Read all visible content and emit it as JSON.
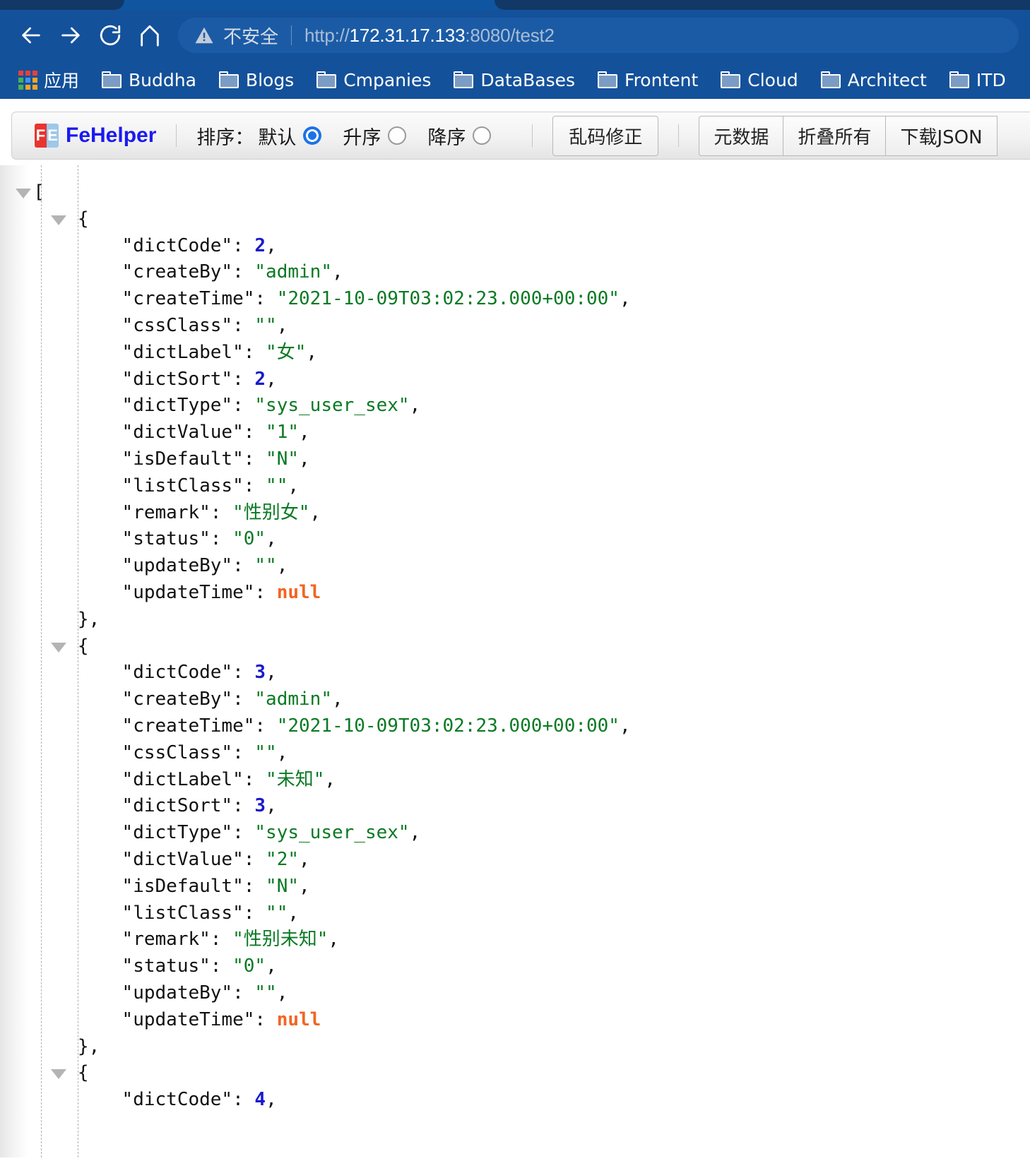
{
  "browser": {
    "tabs": [
      {
        "name": "inactive-tab-left",
        "active": false
      },
      {
        "name": "active-tab",
        "active": true
      },
      {
        "name": "inactive-tab-right",
        "active": false
      }
    ],
    "nav": {
      "back_icon": "arrow-left-icon",
      "forward_icon": "arrow-right-icon",
      "reload_icon": "reload-icon",
      "home_icon": "home-icon"
    },
    "omnibox": {
      "warning_icon": "warning-triangle-icon",
      "security_label": "不安全",
      "url_scheme": "http://",
      "url_host": "172.31.17.133",
      "url_rest": ":8080/test2",
      "url_full": "http://172.31.17.133:8080/test2"
    },
    "bookmarks": [
      {
        "icon": "apps-grid-icon",
        "label": "应用"
      },
      {
        "icon": "folder-icon",
        "label": "Buddha"
      },
      {
        "icon": "folder-icon",
        "label": "Blogs"
      },
      {
        "icon": "folder-icon",
        "label": "Cmpanies"
      },
      {
        "icon": "folder-icon",
        "label": "DataBases"
      },
      {
        "icon": "folder-icon",
        "label": "Frontent"
      },
      {
        "icon": "folder-icon",
        "label": "Cloud"
      },
      {
        "icon": "folder-icon",
        "label": "Architect"
      },
      {
        "icon": "folder-icon",
        "label": "ITD"
      }
    ]
  },
  "fehelper": {
    "brand": "FeHelper",
    "logo_left": "F",
    "logo_right": "E",
    "sort_label": "排序：",
    "sort_options": [
      {
        "label": "默认",
        "checked": true
      },
      {
        "label": "升序",
        "checked": false
      },
      {
        "label": "降序",
        "checked": false
      }
    ],
    "fix_button": "乱码修正",
    "group_buttons": [
      "元数据",
      "折叠所有",
      "下载JSON"
    ]
  },
  "json_lines": [
    {
      "indent": 0,
      "fold": true,
      "tokens": [
        {
          "t": "pnc",
          "v": "["
        }
      ]
    },
    {
      "indent": 1,
      "fold": true,
      "tokens": [
        {
          "t": "pnc",
          "v": "{"
        }
      ]
    },
    {
      "indent": 2,
      "tokens": [
        {
          "t": "k",
          "v": "\"dictCode\""
        },
        {
          "t": "pnc",
          "v": ": "
        },
        {
          "t": "num",
          "v": "2"
        },
        {
          "t": "pnc",
          "v": ","
        }
      ]
    },
    {
      "indent": 2,
      "tokens": [
        {
          "t": "k",
          "v": "\"createBy\""
        },
        {
          "t": "pnc",
          "v": ": "
        },
        {
          "t": "str",
          "v": "\"admin\""
        },
        {
          "t": "pnc",
          "v": ","
        }
      ]
    },
    {
      "indent": 2,
      "tokens": [
        {
          "t": "k",
          "v": "\"createTime\""
        },
        {
          "t": "pnc",
          "v": ": "
        },
        {
          "t": "str",
          "v": "\"2021-10-09T03:02:23.000+00:00\""
        },
        {
          "t": "pnc",
          "v": ","
        }
      ]
    },
    {
      "indent": 2,
      "tokens": [
        {
          "t": "k",
          "v": "\"cssClass\""
        },
        {
          "t": "pnc",
          "v": ": "
        },
        {
          "t": "str",
          "v": "\"\""
        },
        {
          "t": "pnc",
          "v": ","
        }
      ]
    },
    {
      "indent": 2,
      "tokens": [
        {
          "t": "k",
          "v": "\"dictLabel\""
        },
        {
          "t": "pnc",
          "v": ": "
        },
        {
          "t": "str",
          "v": "\"女\""
        },
        {
          "t": "pnc",
          "v": ","
        }
      ]
    },
    {
      "indent": 2,
      "tokens": [
        {
          "t": "k",
          "v": "\"dictSort\""
        },
        {
          "t": "pnc",
          "v": ": "
        },
        {
          "t": "num",
          "v": "2"
        },
        {
          "t": "pnc",
          "v": ","
        }
      ]
    },
    {
      "indent": 2,
      "tokens": [
        {
          "t": "k",
          "v": "\"dictType\""
        },
        {
          "t": "pnc",
          "v": ": "
        },
        {
          "t": "str",
          "v": "\"sys_user_sex\""
        },
        {
          "t": "pnc",
          "v": ","
        }
      ]
    },
    {
      "indent": 2,
      "tokens": [
        {
          "t": "k",
          "v": "\"dictValue\""
        },
        {
          "t": "pnc",
          "v": ": "
        },
        {
          "t": "str",
          "v": "\"1\""
        },
        {
          "t": "pnc",
          "v": ","
        }
      ]
    },
    {
      "indent": 2,
      "tokens": [
        {
          "t": "k",
          "v": "\"isDefault\""
        },
        {
          "t": "pnc",
          "v": ": "
        },
        {
          "t": "str",
          "v": "\"N\""
        },
        {
          "t": "pnc",
          "v": ","
        }
      ]
    },
    {
      "indent": 2,
      "tokens": [
        {
          "t": "k",
          "v": "\"listClass\""
        },
        {
          "t": "pnc",
          "v": ": "
        },
        {
          "t": "str",
          "v": "\"\""
        },
        {
          "t": "pnc",
          "v": ","
        }
      ]
    },
    {
      "indent": 2,
      "tokens": [
        {
          "t": "k",
          "v": "\"remark\""
        },
        {
          "t": "pnc",
          "v": ": "
        },
        {
          "t": "str",
          "v": "\"性别女\""
        },
        {
          "t": "pnc",
          "v": ","
        }
      ]
    },
    {
      "indent": 2,
      "tokens": [
        {
          "t": "k",
          "v": "\"status\""
        },
        {
          "t": "pnc",
          "v": ": "
        },
        {
          "t": "str",
          "v": "\"0\""
        },
        {
          "t": "pnc",
          "v": ","
        }
      ]
    },
    {
      "indent": 2,
      "tokens": [
        {
          "t": "k",
          "v": "\"updateBy\""
        },
        {
          "t": "pnc",
          "v": ": "
        },
        {
          "t": "str",
          "v": "\"\""
        },
        {
          "t": "pnc",
          "v": ","
        }
      ]
    },
    {
      "indent": 2,
      "tokens": [
        {
          "t": "k",
          "v": "\"updateTime\""
        },
        {
          "t": "pnc",
          "v": ": "
        },
        {
          "t": "nul",
          "v": "null"
        }
      ]
    },
    {
      "indent": 1,
      "tokens": [
        {
          "t": "pnc",
          "v": "},"
        }
      ]
    },
    {
      "indent": 1,
      "fold": true,
      "tokens": [
        {
          "t": "pnc",
          "v": "{"
        }
      ]
    },
    {
      "indent": 2,
      "tokens": [
        {
          "t": "k",
          "v": "\"dictCode\""
        },
        {
          "t": "pnc",
          "v": ": "
        },
        {
          "t": "num",
          "v": "3"
        },
        {
          "t": "pnc",
          "v": ","
        }
      ]
    },
    {
      "indent": 2,
      "tokens": [
        {
          "t": "k",
          "v": "\"createBy\""
        },
        {
          "t": "pnc",
          "v": ": "
        },
        {
          "t": "str",
          "v": "\"admin\""
        },
        {
          "t": "pnc",
          "v": ","
        }
      ]
    },
    {
      "indent": 2,
      "tokens": [
        {
          "t": "k",
          "v": "\"createTime\""
        },
        {
          "t": "pnc",
          "v": ": "
        },
        {
          "t": "str",
          "v": "\"2021-10-09T03:02:23.000+00:00\""
        },
        {
          "t": "pnc",
          "v": ","
        }
      ]
    },
    {
      "indent": 2,
      "tokens": [
        {
          "t": "k",
          "v": "\"cssClass\""
        },
        {
          "t": "pnc",
          "v": ": "
        },
        {
          "t": "str",
          "v": "\"\""
        },
        {
          "t": "pnc",
          "v": ","
        }
      ]
    },
    {
      "indent": 2,
      "tokens": [
        {
          "t": "k",
          "v": "\"dictLabel\""
        },
        {
          "t": "pnc",
          "v": ": "
        },
        {
          "t": "str",
          "v": "\"未知\""
        },
        {
          "t": "pnc",
          "v": ","
        }
      ]
    },
    {
      "indent": 2,
      "tokens": [
        {
          "t": "k",
          "v": "\"dictSort\""
        },
        {
          "t": "pnc",
          "v": ": "
        },
        {
          "t": "num",
          "v": "3"
        },
        {
          "t": "pnc",
          "v": ","
        }
      ]
    },
    {
      "indent": 2,
      "tokens": [
        {
          "t": "k",
          "v": "\"dictType\""
        },
        {
          "t": "pnc",
          "v": ": "
        },
        {
          "t": "str",
          "v": "\"sys_user_sex\""
        },
        {
          "t": "pnc",
          "v": ","
        }
      ]
    },
    {
      "indent": 2,
      "tokens": [
        {
          "t": "k",
          "v": "\"dictValue\""
        },
        {
          "t": "pnc",
          "v": ": "
        },
        {
          "t": "str",
          "v": "\"2\""
        },
        {
          "t": "pnc",
          "v": ","
        }
      ]
    },
    {
      "indent": 2,
      "tokens": [
        {
          "t": "k",
          "v": "\"isDefault\""
        },
        {
          "t": "pnc",
          "v": ": "
        },
        {
          "t": "str",
          "v": "\"N\""
        },
        {
          "t": "pnc",
          "v": ","
        }
      ]
    },
    {
      "indent": 2,
      "tokens": [
        {
          "t": "k",
          "v": "\"listClass\""
        },
        {
          "t": "pnc",
          "v": ": "
        },
        {
          "t": "str",
          "v": "\"\""
        },
        {
          "t": "pnc",
          "v": ","
        }
      ]
    },
    {
      "indent": 2,
      "tokens": [
        {
          "t": "k",
          "v": "\"remark\""
        },
        {
          "t": "pnc",
          "v": ": "
        },
        {
          "t": "str",
          "v": "\"性别未知\""
        },
        {
          "t": "pnc",
          "v": ","
        }
      ]
    },
    {
      "indent": 2,
      "tokens": [
        {
          "t": "k",
          "v": "\"status\""
        },
        {
          "t": "pnc",
          "v": ": "
        },
        {
          "t": "str",
          "v": "\"0\""
        },
        {
          "t": "pnc",
          "v": ","
        }
      ]
    },
    {
      "indent": 2,
      "tokens": [
        {
          "t": "k",
          "v": "\"updateBy\""
        },
        {
          "t": "pnc",
          "v": ": "
        },
        {
          "t": "str",
          "v": "\"\""
        },
        {
          "t": "pnc",
          "v": ","
        }
      ]
    },
    {
      "indent": 2,
      "tokens": [
        {
          "t": "k",
          "v": "\"updateTime\""
        },
        {
          "t": "pnc",
          "v": ": "
        },
        {
          "t": "nul",
          "v": "null"
        }
      ]
    },
    {
      "indent": 1,
      "tokens": [
        {
          "t": "pnc",
          "v": "},"
        }
      ]
    },
    {
      "indent": 1,
      "fold": true,
      "tokens": [
        {
          "t": "pnc",
          "v": "{"
        }
      ]
    },
    {
      "indent": 2,
      "tokens": [
        {
          "t": "k",
          "v": "\"dictCode\""
        },
        {
          "t": "pnc",
          "v": ": "
        },
        {
          "t": "num",
          "v": "4"
        },
        {
          "t": "pnc",
          "v": ","
        }
      ]
    }
  ],
  "colors": {
    "chrome_blue": "#14519b",
    "tab_dark": "#123867",
    "string_green": "#0a7a23",
    "number_blue": "#1a1acc",
    "null_orange": "#f26522",
    "accent_radio": "#1a73e8",
    "brand_blue": "#1a1af0"
  }
}
